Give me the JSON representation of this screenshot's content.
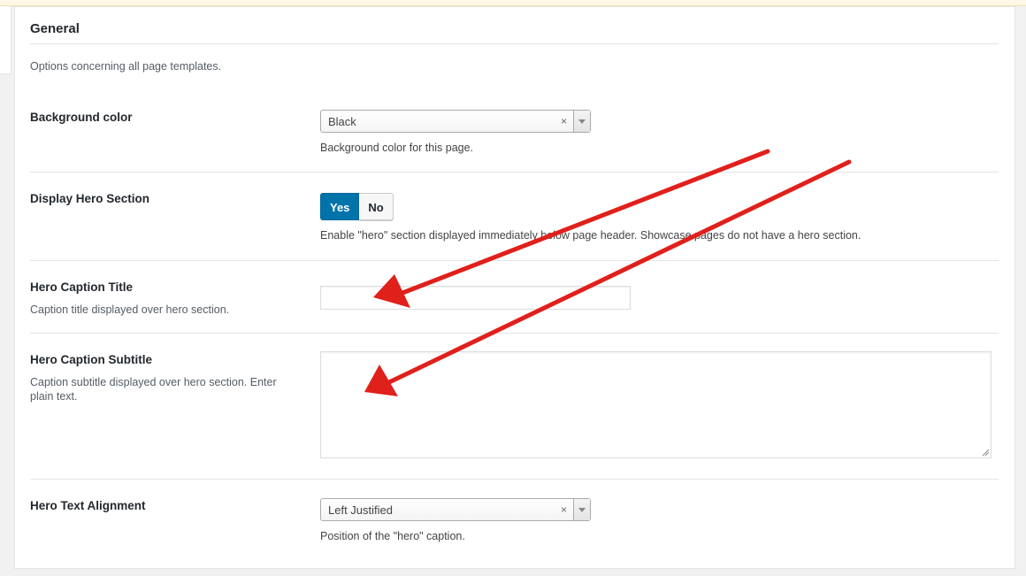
{
  "section": {
    "title": "General",
    "description": "Options concerning all page templates."
  },
  "fields": {
    "background_color": {
      "label": "Background color",
      "selected": "Black",
      "clear_symbol": "×",
      "help": "Background color for this page."
    },
    "display_hero": {
      "label": "Display Hero Section",
      "yes_label": "Yes",
      "no_label": "No",
      "selected": "Yes",
      "help": "Enable \"hero\" section displayed immediately below page header. Showcase pages do not have a hero section."
    },
    "hero_caption_title": {
      "label": "Hero Caption Title",
      "description": "Caption title displayed over hero section.",
      "value": ""
    },
    "hero_caption_subtitle": {
      "label": "Hero Caption Subtitle",
      "description": "Caption subtitle displayed over hero section. Enter plain text.",
      "value": ""
    },
    "hero_text_alignment": {
      "label": "Hero Text Alignment",
      "selected": "Left Justified",
      "clear_symbol": "×",
      "help": "Position of the \"hero\" caption."
    }
  },
  "annotations": {
    "arrow_color": "#e0201b"
  },
  "colors": {
    "primary": "#0073aa",
    "border": "#e5e5e5",
    "background": "#f1f1f1"
  }
}
